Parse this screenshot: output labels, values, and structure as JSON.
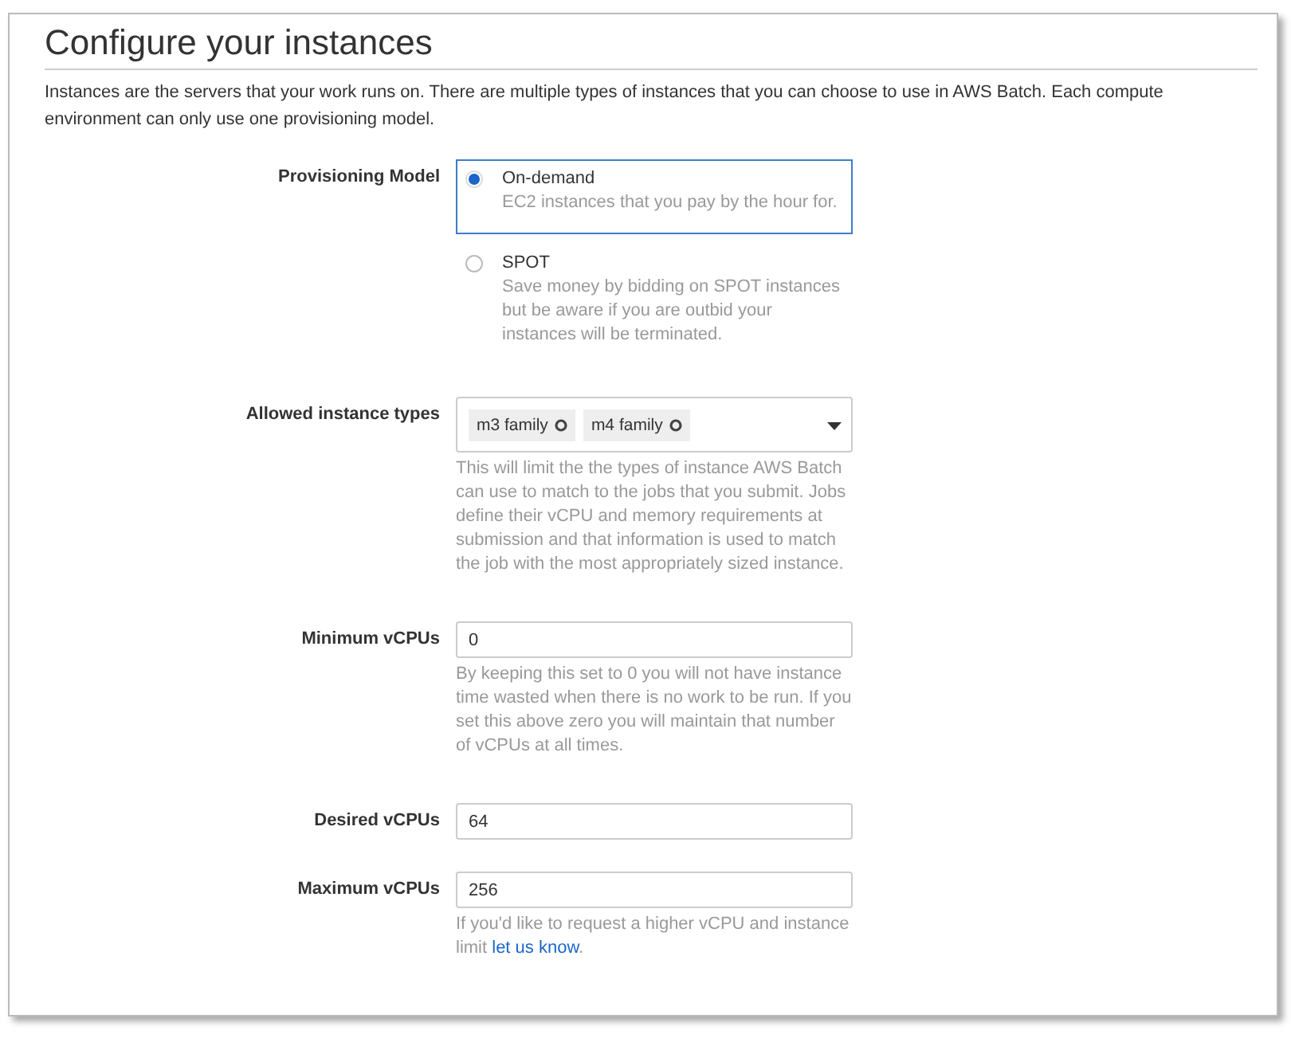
{
  "title": "Configure your instances",
  "description": "Instances are the servers that your work runs on. There are multiple types of instances that you can choose to use in AWS Batch. Each compute environment can only use one provisioning model.",
  "fields": [
    {
      "kind": "radio",
      "label": "Provisioning Model",
      "options": [
        {
          "label": "On-demand",
          "description": "EC2 instances that you pay by the hour for.",
          "selected": true
        },
        {
          "label": "SPOT",
          "description": "Save money by bidding on SPOT instances but be aware if you are outbid your instances will be terminated.",
          "selected": false
        }
      ]
    },
    {
      "kind": "multiselect",
      "label": "Allowed instance types",
      "tags": [
        "m3 family",
        "m4 family"
      ],
      "help": "This will limit the the types of instance AWS Batch can use to match to the jobs that you submit. Jobs define their vCPU and memory requirements at submission and that information is used to match the job with the most appropriately sized instance."
    },
    {
      "kind": "text",
      "label": "Minimum vCPUs",
      "value": "0",
      "help": "By keeping this set to 0 you will not have instance time wasted when there is no work to be run. If you set this above zero you will maintain that number of vCPUs at all times."
    },
    {
      "kind": "text",
      "label": "Desired vCPUs",
      "value": "64"
    },
    {
      "kind": "text",
      "label": "Maximum vCPUs",
      "value": "256",
      "help": "If you'd like to request a higher vCPU and instance limit",
      "link": "let us know",
      "help_end": "."
    }
  ]
}
